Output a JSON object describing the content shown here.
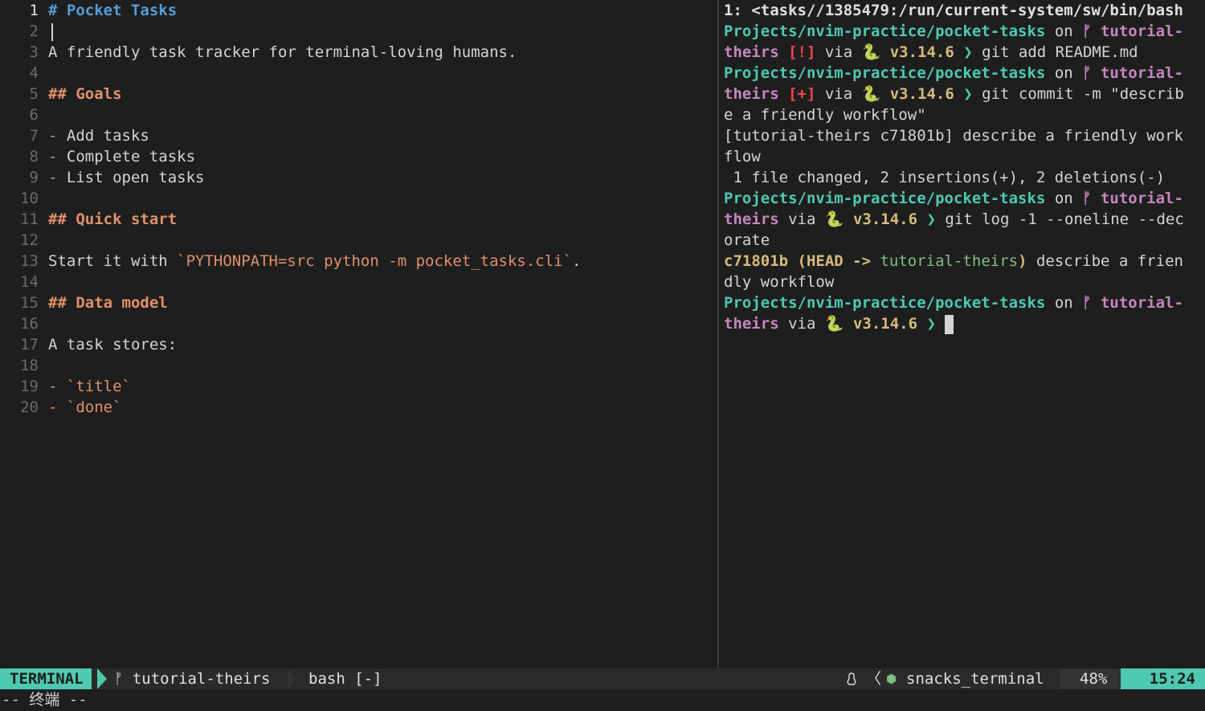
{
  "editor": {
    "lines": [
      {
        "n": "1",
        "segments": [
          {
            "t": "# Pocket Tasks",
            "c": "h1"
          }
        ]
      },
      {
        "n": "2",
        "segments": []
      },
      {
        "n": "3",
        "segments": [
          {
            "t": "A friendly task tracker for terminal-loving humans.",
            "c": ""
          }
        ]
      },
      {
        "n": "4",
        "segments": []
      },
      {
        "n": "5",
        "segments": [
          {
            "t": "## Goals",
            "c": "h2"
          }
        ]
      },
      {
        "n": "6",
        "segments": []
      },
      {
        "n": "7",
        "segments": [
          {
            "t": "-",
            "c": "bullet"
          },
          {
            "t": " Add tasks",
            "c": ""
          }
        ]
      },
      {
        "n": "8",
        "segments": [
          {
            "t": "-",
            "c": "bullet"
          },
          {
            "t": " Complete tasks",
            "c": ""
          }
        ]
      },
      {
        "n": "9",
        "segments": [
          {
            "t": "-",
            "c": "bullet"
          },
          {
            "t": " List open tasks",
            "c": ""
          }
        ]
      },
      {
        "n": "10",
        "segments": []
      },
      {
        "n": "11",
        "segments": [
          {
            "t": "## Quick start",
            "c": "h2"
          }
        ]
      },
      {
        "n": "12",
        "segments": []
      },
      {
        "n": "13",
        "segments": [
          {
            "t": "Start it with ",
            "c": ""
          },
          {
            "t": "`PYTHONPATH=src python -m pocket_tasks.cli`",
            "c": "code"
          },
          {
            "t": ".",
            "c": ""
          }
        ]
      },
      {
        "n": "14",
        "segments": []
      },
      {
        "n": "15",
        "segments": [
          {
            "t": "## Data model",
            "c": "h2"
          }
        ]
      },
      {
        "n": "16",
        "segments": []
      },
      {
        "n": "17",
        "segments": [
          {
            "t": "A task stores:",
            "c": ""
          }
        ]
      },
      {
        "n": "18",
        "segments": []
      },
      {
        "n": "19",
        "segments": [
          {
            "t": "-",
            "c": "bullet"
          },
          {
            "t": " ",
            "c": ""
          },
          {
            "t": "`title`",
            "c": "code"
          }
        ]
      },
      {
        "n": "20",
        "segments": [
          {
            "t": "-",
            "c": "bullet"
          },
          {
            "t": " ",
            "c": ""
          },
          {
            "t": "`done`",
            "c": "code"
          }
        ]
      }
    ]
  },
  "terminal": {
    "lines": [
      [
        {
          "t": "1: <tasks//1385479:/run/current-system/sw/bin/bash",
          "c": "white-b"
        }
      ],
      [
        {
          "t": "Projects/nvim-practice/pocket-tasks",
          "c": "path"
        },
        {
          "t": " on ",
          "c": "dim"
        },
        {
          "t": "ᚠ tutorial-",
          "c": "branch"
        }
      ],
      [
        {
          "t": "theirs",
          "c": "branch"
        },
        {
          "t": " ",
          "c": "dim"
        },
        {
          "t": "[!]",
          "c": "stat"
        },
        {
          "t": " via ",
          "c": "dim"
        },
        {
          "t": "🐍 v3.14.6",
          "c": "pyver"
        },
        {
          "t": " ❯ ",
          "c": "prompt-ch"
        },
        {
          "t": "git add README.md",
          "c": "dim"
        }
      ],
      [
        {
          "t": "Projects/nvim-practice/pocket-tasks",
          "c": "path"
        },
        {
          "t": " on ",
          "c": "dim"
        },
        {
          "t": "ᚠ tutorial-",
          "c": "branch"
        }
      ],
      [
        {
          "t": "theirs",
          "c": "branch"
        },
        {
          "t": " ",
          "c": "dim"
        },
        {
          "t": "[+]",
          "c": "stat"
        },
        {
          "t": " via ",
          "c": "dim"
        },
        {
          "t": "🐍 v3.14.6",
          "c": "pyver"
        },
        {
          "t": " ❯ ",
          "c": "prompt-ch"
        },
        {
          "t": "git commit -m \"describ",
          "c": "dim"
        }
      ],
      [
        {
          "t": "e a friendly workflow\"",
          "c": "dim"
        }
      ],
      [
        {
          "t": "[tutorial-theirs c71801b] describe a friendly work",
          "c": "dim"
        }
      ],
      [
        {
          "t": "flow",
          "c": "dim"
        }
      ],
      [
        {
          "t": " 1 file changed, 2 insertions(+), 2 deletions(-)",
          "c": "dim"
        }
      ],
      [
        {
          "t": "Projects/nvim-practice/pocket-tasks",
          "c": "path"
        },
        {
          "t": " on ",
          "c": "dim"
        },
        {
          "t": "ᚠ tutorial-",
          "c": "branch"
        }
      ],
      [
        {
          "t": "theirs",
          "c": "branch"
        },
        {
          "t": " via ",
          "c": "dim"
        },
        {
          "t": "🐍 v3.14.6",
          "c": "pyver"
        },
        {
          "t": " ❯ ",
          "c": "prompt-ch"
        },
        {
          "t": "git log -1 --oneline --dec",
          "c": "dim"
        }
      ],
      [
        {
          "t": "orate",
          "c": "dim"
        }
      ],
      [
        {
          "t": "c71801b ",
          "c": "pyver"
        },
        {
          "t": "(",
          "c": "pyver"
        },
        {
          "t": "HEAD -> ",
          "c": "head-kw"
        },
        {
          "t": "tutorial-theirs",
          "c": "branch-g"
        },
        {
          "t": ")",
          "c": "pyver"
        },
        {
          "t": " describe a frien",
          "c": "dim"
        }
      ],
      [
        {
          "t": "dly workflow",
          "c": "dim"
        }
      ],
      [
        {
          "t": "Projects/nvim-practice/pocket-tasks",
          "c": "path"
        },
        {
          "t": " on ",
          "c": "dim"
        },
        {
          "t": "ᚠ tutorial-",
          "c": "branch"
        }
      ],
      [
        {
          "t": "theirs",
          "c": "branch"
        },
        {
          "t": " via ",
          "c": "dim"
        },
        {
          "t": "🐍 v3.14.6",
          "c": "pyver"
        },
        {
          "t": " ❯ ",
          "c": "prompt-ch"
        }
      ]
    ]
  },
  "statusline": {
    "mode": "TERMINAL",
    "branch": "ᚠ tutorial-theirs",
    "file": "bash [-]",
    "os_icon": "linux-icon",
    "lt": "〈",
    "filetype_icon": "⬢",
    "filetype": "snacks_terminal",
    "percent": "48%",
    "time": "15:24"
  },
  "cmdline": "-- 终端 --",
  "colors": {
    "accent": "#4ec9b0",
    "background": "#1e1e1e",
    "heading1": "#569cd6",
    "heading2": "#e0916b",
    "branch": "#c586c0"
  }
}
